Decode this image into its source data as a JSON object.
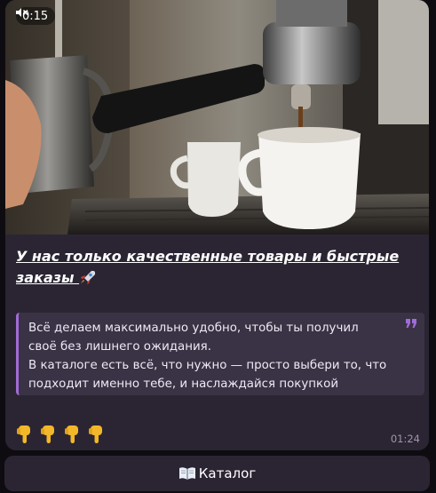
{
  "message": {
    "video_duration": "0:15",
    "mute_icon": "muted-speaker-icon",
    "title": "У нас только качественные товары и быстрые заказы",
    "title_emoji_icon": "rocket-icon",
    "quote_lines": [
      "Всё делаем максимально удобно, чтобы ты получил",
      "своё без лишнего ожидания.",
      "В каталоге есть всё, что нужно — просто выбери то, что",
      "подходит именно тебе, и наслаждайся покупкой"
    ],
    "quote_icon": "quote-mark-icon",
    "emoji_icons": [
      "pointing-down-hand-icon",
      "pointing-down-hand-icon",
      "pointing-down-hand-icon",
      "pointing-down-hand-icon"
    ],
    "time": "01:24"
  },
  "keyboard": {
    "button_label": "Каталог",
    "button_icon": "open-book-icon"
  },
  "colors": {
    "chat_background": "#0e0c10",
    "bubble": "#2b2533",
    "quote_bar": "#a06cd5",
    "quote_background": "#3a3245",
    "timestamp": "#9f95ad"
  }
}
